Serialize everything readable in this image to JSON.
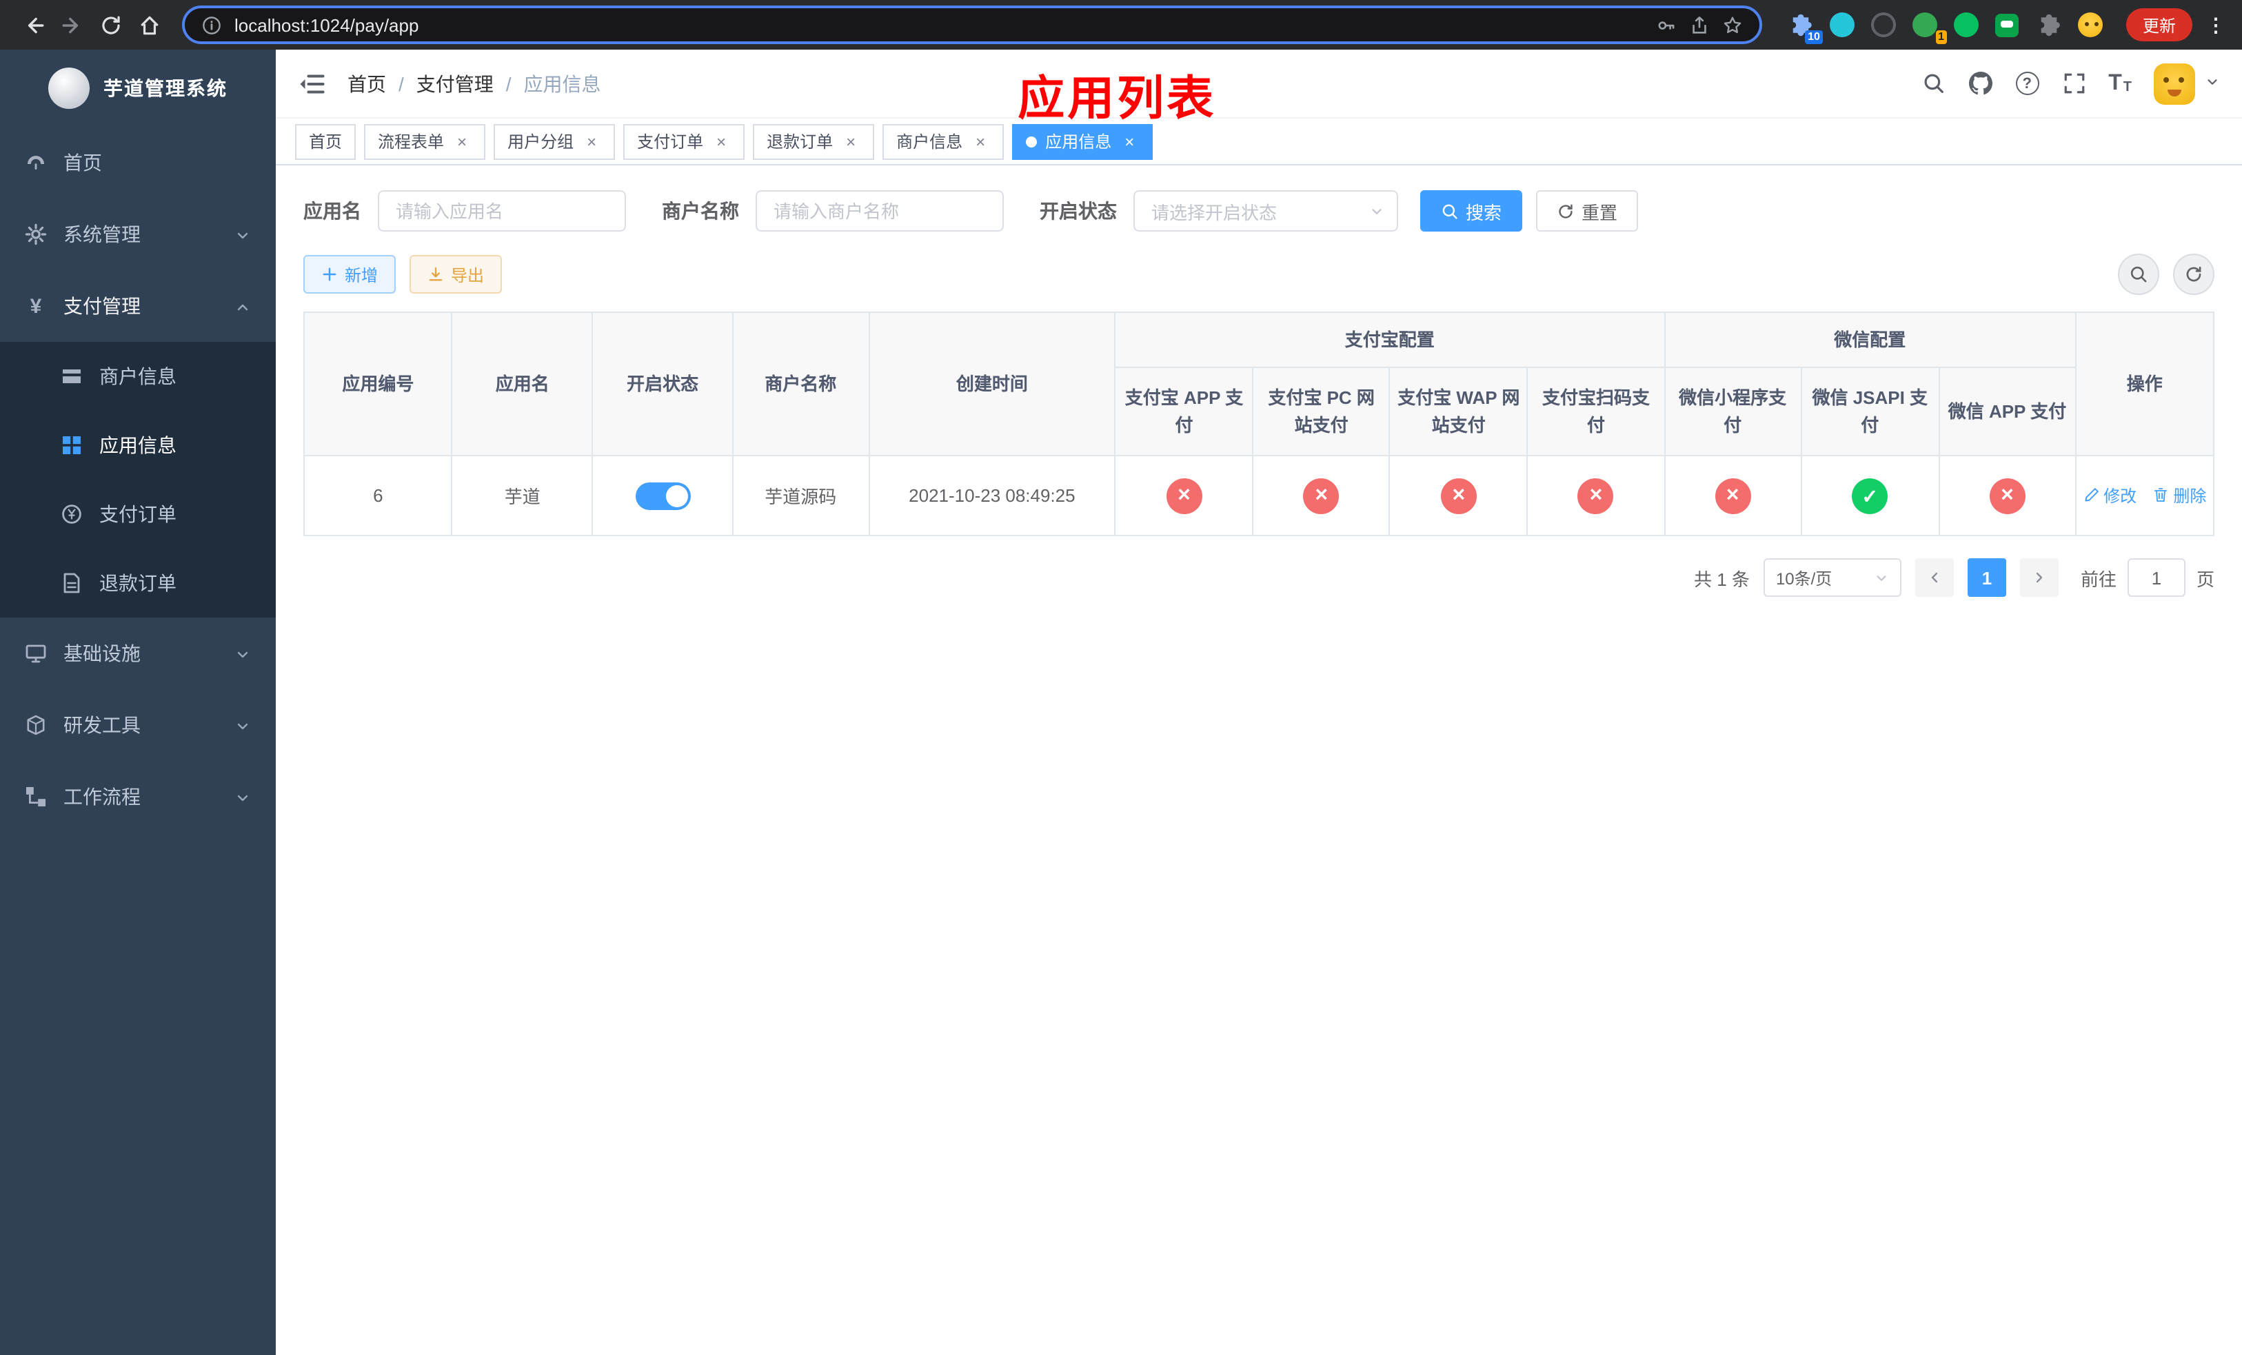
{
  "colors": {
    "primary": "#409eff",
    "success": "#13ce66",
    "danger": "#f56c6c",
    "warning": "#e6a23c",
    "annotation_red": "#ff0000",
    "sidebar_bg": "#304156",
    "submenu_bg": "#1f2d3d"
  },
  "browser": {
    "url": "localhost:1024/pay/app",
    "update_button": "更新",
    "ext_badge_puzzle": "10",
    "ext_badge_green": "1"
  },
  "sidebar": {
    "logo_title": "芋道管理系统",
    "items": [
      {
        "label": "首页"
      },
      {
        "label": "系统管理"
      },
      {
        "label": "支付管理"
      },
      {
        "label": "基础设施"
      },
      {
        "label": "研发工具"
      },
      {
        "label": "工作流程"
      }
    ],
    "payment_children": [
      {
        "label": "商户信息"
      },
      {
        "label": "应用信息"
      },
      {
        "label": "支付订单"
      },
      {
        "label": "退款订单"
      }
    ]
  },
  "navbar": {
    "breadcrumb": [
      "首页",
      "支付管理",
      "应用信息"
    ]
  },
  "annotation": "应用列表",
  "tabs": [
    {
      "label": "首页"
    },
    {
      "label": "流程表单"
    },
    {
      "label": "用户分组"
    },
    {
      "label": "支付订单"
    },
    {
      "label": "退款订单"
    },
    {
      "label": "商户信息"
    },
    {
      "label": "应用信息"
    }
  ],
  "filters": {
    "app_name_label": "应用名",
    "app_name_placeholder": "请输入应用名",
    "merchant_label": "商户名称",
    "merchant_placeholder": "请输入商户名称",
    "status_label": "开启状态",
    "status_placeholder": "请选择开启状态",
    "search_button": "搜索",
    "reset_button": "重置"
  },
  "toolbar": {
    "add_button": "新增",
    "export_button": "导出"
  },
  "table": {
    "groups": {
      "alipay": "支付宝配置",
      "wechat": "微信配置"
    },
    "columns": {
      "id": "应用编号",
      "name": "应用名",
      "status": "开启状态",
      "merchant": "商户名称",
      "created": "创建时间",
      "alipay_app": "支付宝 APP 支付",
      "alipay_pc": "支付宝 PC 网站支付",
      "alipay_wap": "支付宝 WAP 网站支付",
      "alipay_qr": "支付宝扫码支付",
      "wx_mini": "微信小程序支付",
      "wx_jsapi": "微信 JSAPI 支付",
      "wx_app": "微信 APP 支付",
      "ops": "操作"
    },
    "row": {
      "id": "6",
      "name": "芋道",
      "enabled": "true",
      "merchant": "芋道源码",
      "created": "2021-10-23 08:49:25",
      "alipay_app": "no",
      "alipay_pc": "no",
      "alipay_wap": "no",
      "alipay_qr": "no",
      "wx_mini": "no",
      "wx_jsapi": "yes",
      "wx_app": "no",
      "edit": "修改",
      "delete": "删除"
    }
  },
  "pagination": {
    "total": "共 1 条",
    "page_size": "10条/页",
    "page": "1",
    "goto_label": "前往",
    "goto_value": "1",
    "goto_suffix": "页"
  }
}
